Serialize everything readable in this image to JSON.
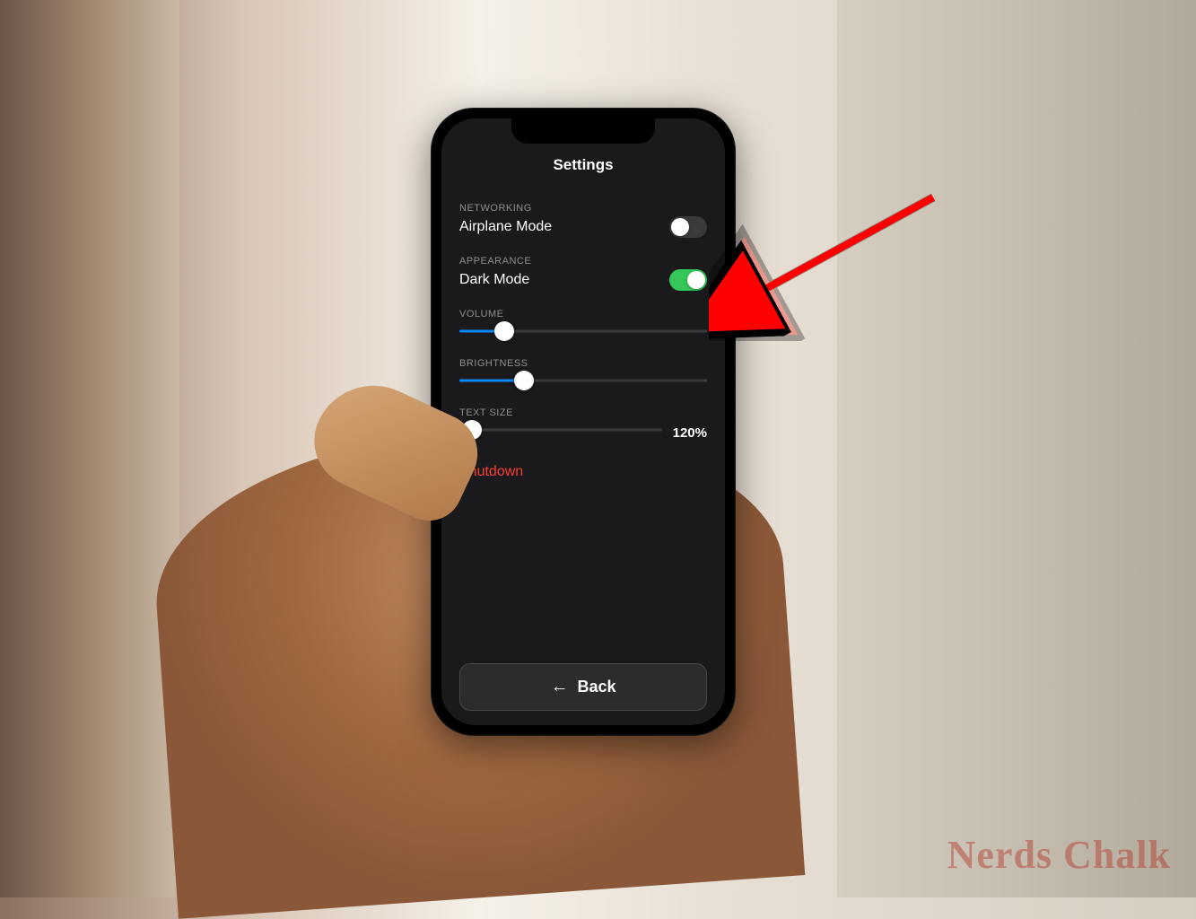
{
  "screen": {
    "title": "Settings",
    "sections": {
      "networking": {
        "label": "NETWORKING",
        "airplane": {
          "label": "Airplane Mode",
          "enabled": false
        }
      },
      "appearance": {
        "label": "APPEARANCE",
        "darkmode": {
          "label": "Dark Mode",
          "enabled": true
        }
      },
      "volume": {
        "label": "VOLUME",
        "percent": 18
      },
      "brightness": {
        "label": "BRIGHTNESS",
        "percent": 26
      },
      "textsize": {
        "label": "TEXT SIZE",
        "percent": 6,
        "display": "120%"
      }
    },
    "shutdown": "Shutdown",
    "back": "Back"
  },
  "watermark": "Nerds Chalk",
  "colors": {
    "toggle_on": "#34c759",
    "toggle_off": "#3a3a3c",
    "slider_fill": "#0a84ff",
    "danger": "#ff3b30"
  }
}
